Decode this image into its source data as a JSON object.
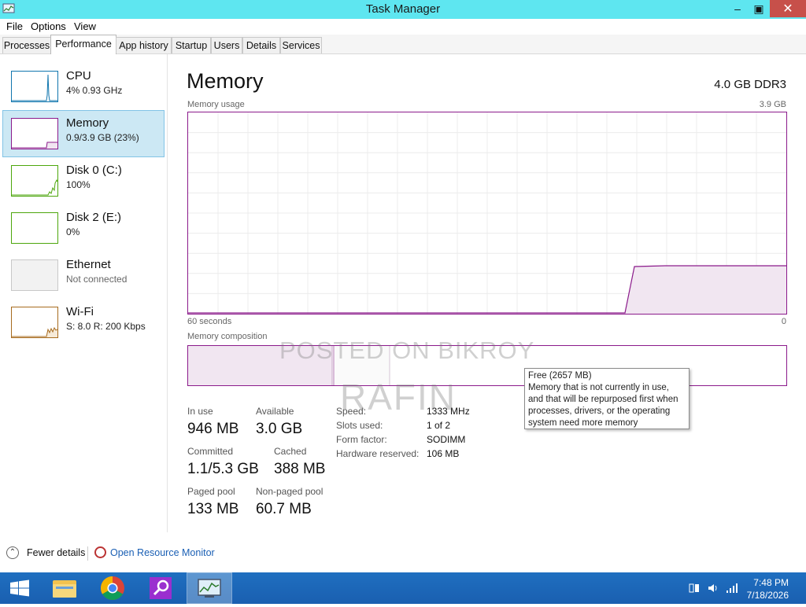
{
  "window": {
    "title": "Task Manager",
    "minimize_glyph": "–",
    "maximize_glyph": "▣",
    "close_glyph": "✕"
  },
  "menu": [
    "File",
    "Options",
    "View"
  ],
  "tabs": [
    "Processes",
    "Performance",
    "App history",
    "Startup",
    "Users",
    "Details",
    "Services"
  ],
  "active_tab": "Performance",
  "sidebar": {
    "items": [
      {
        "name": "CPU",
        "sub": "4% 0.93 GHz",
        "color": "#1176ae"
      },
      {
        "name": "Memory",
        "sub": "0.9/3.9 GB (23%)",
        "color": "#8b1a8b"
      },
      {
        "name": "Disk 0 (C:)",
        "sub": "100%",
        "color": "#4da60c"
      },
      {
        "name": "Disk 2 (E:)",
        "sub": "0%",
        "color": "#4da60c"
      },
      {
        "name": "Ethernet",
        "sub": "Not connected",
        "color": "#a0a0a0"
      },
      {
        "name": "Wi-Fi",
        "sub": "S: 8.0  R: 200 Kbps",
        "color": "#a76b1e"
      }
    ]
  },
  "main": {
    "title": "Memory",
    "spec": "4.0 GB DDR3",
    "usage_label": "Memory usage",
    "usage_max": "3.9 GB",
    "time_left": "60 seconds",
    "time_right": "0",
    "composition_label": "Memory composition",
    "usage_fraction": 0.23
  },
  "tooltip": {
    "title": "Free (2657 MB)",
    "lines": [
      "Memory that is not currently in use,",
      "and that will be repurposed first when",
      "processes, drivers, or the operating",
      "system need more memory"
    ]
  },
  "stats": {
    "in_use_label": "In use",
    "in_use": "946 MB",
    "available_label": "Available",
    "available": "3.0 GB",
    "committed_label": "Committed",
    "committed": "1.1/5.3 GB",
    "cached_label": "Cached",
    "cached": "388 MB",
    "paged_label": "Paged pool",
    "paged": "133 MB",
    "nonpaged_label": "Non-paged pool",
    "nonpaged": "60.7 MB"
  },
  "details": [
    {
      "key": "Speed:",
      "value": "1333 MHz"
    },
    {
      "key": "Slots used:",
      "value": "1 of 2"
    },
    {
      "key": "Form factor:",
      "value": "SODIMM"
    },
    {
      "key": "Hardware reserved:",
      "value": "106 MB"
    }
  ],
  "watermark": {
    "line1": "POSTED ON BIKROY",
    "line2": "RAFIN"
  },
  "footer": {
    "fewer_details": "Fewer details",
    "resource_monitor": "Open Resource Monitor"
  },
  "clock": {
    "time": "7:48 PM",
    "date": "7/18/2026"
  },
  "colors": {
    "memory": "#8b1a8b",
    "titlebar": "#5ee6f0",
    "selection": "#cce8f4"
  }
}
